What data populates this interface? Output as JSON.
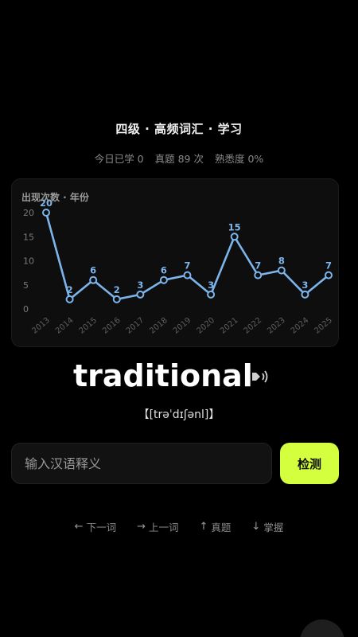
{
  "header": {
    "title": "四级 · 高频词汇 · 学习"
  },
  "stats": {
    "today": "今日已学 0",
    "real_exam": "真题 89 次",
    "familiarity": "熟悉度 0%"
  },
  "chart_data": {
    "type": "line",
    "title": "出现次数 · 年份",
    "x": [
      "2013",
      "2014",
      "2015",
      "2016",
      "2017",
      "2018",
      "2019",
      "2020",
      "2021",
      "2022",
      "2023",
      "2024",
      "2025"
    ],
    "series": [
      {
        "values": [
          20,
          2,
          6,
          2,
          3,
          6,
          7,
          3,
          15,
          7,
          8,
          3,
          7
        ]
      }
    ],
    "ylim": [
      0,
      20
    ],
    "yticks": [
      0,
      5,
      10,
      15,
      20
    ],
    "line_color": "#7cb5ec",
    "grid": false
  },
  "word": {
    "text": "traditional",
    "phonetic": "【[trəˈdɪʃənl]】",
    "speaker_icon": "speaker-icon"
  },
  "input": {
    "placeholder": "输入汉语释义",
    "value": ""
  },
  "check_button": {
    "label": "检测",
    "color": "#d4ff3f"
  },
  "shortcuts": [
    {
      "arrow": "←",
      "label": "下一词"
    },
    {
      "arrow": "→",
      "label": "上一词"
    },
    {
      "arrow": "↑",
      "label": "真题"
    },
    {
      "arrow": "↓",
      "label": "掌握"
    }
  ]
}
